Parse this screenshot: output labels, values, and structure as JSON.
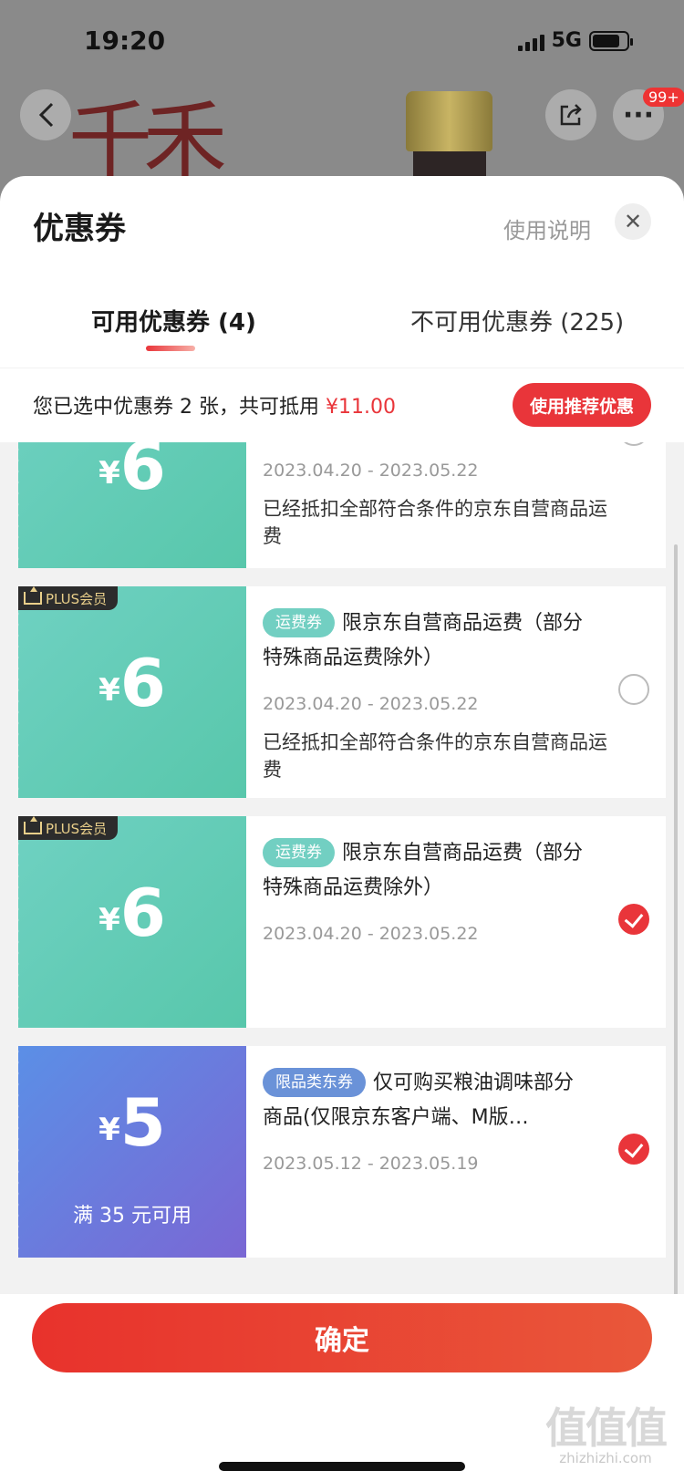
{
  "status": {
    "time": "19:20",
    "network": "5G"
  },
  "background": {
    "brand_chars": "千禾",
    "more_badge": "99+"
  },
  "sheet": {
    "title": "优惠券",
    "help_link": "使用说明",
    "close_icon": "close-icon"
  },
  "tabs": [
    {
      "label": "可用优惠券 (4)",
      "active": true
    },
    {
      "label": "不可用优惠券 (225)",
      "active": false
    }
  ],
  "summary": {
    "text": "您已选中优惠券 2 张，共可抵用 ",
    "amount": "¥11.00",
    "button": "使用推荐优惠"
  },
  "coupons": [
    {
      "style": "teal",
      "plus": false,
      "yen": "¥",
      "amount": "6",
      "date": "2023.04.20 - 2023.05.22",
      "desc": "已经抵扣全部符合条件的京东自营商品运费",
      "checked": false
    },
    {
      "style": "teal",
      "plus": true,
      "plus_label": "PLUS会员",
      "yen": "¥",
      "amount": "6",
      "tag": "运费券",
      "title": "限京东自营商品运费（部分特殊商品运费除外）",
      "date": "2023.04.20 - 2023.05.22",
      "desc": "已经抵扣全部符合条件的京东自营商品运费",
      "checked": false
    },
    {
      "style": "teal",
      "plus": true,
      "plus_label": "PLUS会员",
      "yen": "¥",
      "amount": "6",
      "tag": "运费券",
      "title": "限京东自营商品运费（部分特殊商品运费除外）",
      "date": "2023.04.20 - 2023.05.22",
      "checked": true
    },
    {
      "style": "blue",
      "plus": false,
      "yen": "¥",
      "amount": "5",
      "condition": "满 35 元可用",
      "tag": "限品类东券",
      "title": "仅可购买粮油调味部分商品(仅限京东客户端、M版…",
      "date": "2023.05.12 - 2023.05.19",
      "checked": true
    }
  ],
  "footer": {
    "confirm": "确定"
  },
  "watermark": {
    "big": "值值值",
    "small": "zhizhizhi.com"
  }
}
